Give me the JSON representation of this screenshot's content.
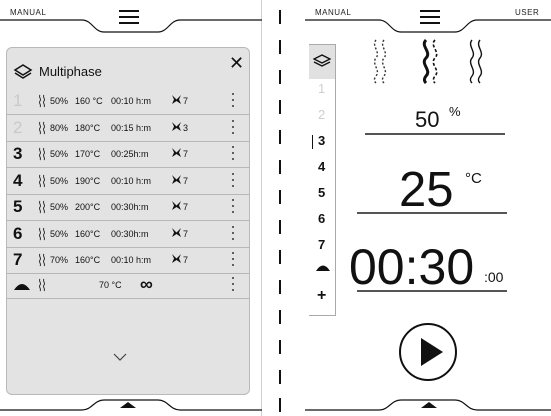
{
  "left_panel": {
    "mode_label": "MANUAL",
    "card": {
      "title": "Multiphase",
      "close_label": "✕",
      "phases": [
        {
          "number": "1",
          "dim": true,
          "humidity": "50%",
          "temperature": "160 °C",
          "time": "00:10 h:m",
          "fan": "7"
        },
        {
          "number": "2",
          "dim": true,
          "humidity": "80%",
          "temperature": "180°C",
          "time": "00:15 h:m",
          "fan": "3"
        },
        {
          "number": "3",
          "dim": false,
          "humidity": "50%",
          "temperature": "170°C",
          "time": "00:25h:m",
          "fan": "7"
        },
        {
          "number": "4",
          "dim": false,
          "humidity": "50%",
          "temperature": "190°C",
          "time": "00:10 h:m",
          "fan": "7"
        },
        {
          "number": "5",
          "dim": false,
          "humidity": "50%",
          "temperature": "200°C",
          "time": "00:30h:m",
          "fan": "7"
        },
        {
          "number": "6",
          "dim": false,
          "humidity": "50%",
          "temperature": "160°C",
          "time": "00:30h:m",
          "fan": "7"
        },
        {
          "number": "7",
          "dim": false,
          "humidity": "70%",
          "temperature": "160°C",
          "time": "00:10 h:m",
          "fan": "7"
        }
      ],
      "hold": {
        "temperature": "70 °C",
        "duration": "∞"
      }
    }
  },
  "right_panel": {
    "mode_label": "MANUAL",
    "user_label": "USER",
    "phase_strip": [
      "1",
      "2",
      "3",
      "4",
      "5",
      "6",
      "7"
    ],
    "add_label": "+",
    "humidity": {
      "value": "50",
      "unit": "%"
    },
    "temperature": {
      "value": "25",
      "unit": "°C"
    },
    "time": {
      "value": "00:30",
      "seconds": ":00"
    }
  },
  "icons": [
    "hamburger-menu-icon",
    "layers-icon",
    "close-icon",
    "steam-icon",
    "fan-icon",
    "more-vertical-icon",
    "hold-dome-icon",
    "infinity-icon",
    "chevron-down-icon",
    "chevron-up-icon",
    "play-icon",
    "plus-icon"
  ]
}
